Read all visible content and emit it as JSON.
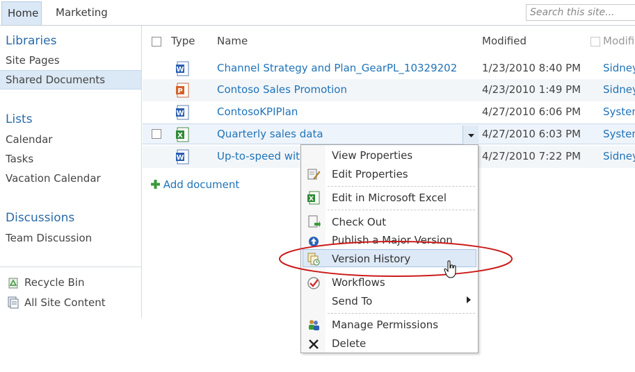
{
  "top_nav": {
    "tabs": [
      {
        "label": "Home"
      },
      {
        "label": "Marketing"
      }
    ],
    "search_placeholder": "Search this site..."
  },
  "left_nav": {
    "libraries": {
      "heading": "Libraries",
      "items": [
        {
          "label": "Site Pages"
        },
        {
          "label": "Shared Documents"
        }
      ]
    },
    "lists": {
      "heading": "Lists",
      "items": [
        {
          "label": "Calendar"
        },
        {
          "label": "Tasks"
        },
        {
          "label": "Vacation Calendar"
        }
      ]
    },
    "discussions": {
      "heading": "Discussions",
      "items": [
        {
          "label": "Team Discussion"
        }
      ]
    },
    "bottom": [
      {
        "label": "Recycle Bin",
        "icon": "recycle-bin-icon"
      },
      {
        "label": "All Site Content",
        "icon": "all-site-content-icon"
      }
    ]
  },
  "list": {
    "columns": {
      "type": "Type",
      "name": "Name",
      "modified": "Modified",
      "modified_by": "Modifi"
    },
    "rows": [
      {
        "icon": "word-doc-icon",
        "name": "Channel Strategy and Plan_GearPL_10329202",
        "modified": "1/23/2010 8:40 PM",
        "modified_by": "Sidney"
      },
      {
        "icon": "powerpoint-doc-icon",
        "name": "Contoso Sales Promotion",
        "modified": "4/23/2010 1:49 PM",
        "modified_by": "Sidney"
      },
      {
        "icon": "word-doc-icon",
        "name": "ContosoKPIPlan",
        "modified": "4/27/2010 6:06 PM",
        "modified_by": "System"
      },
      {
        "icon": "excel-doc-icon",
        "name": "Quarterly sales data",
        "modified": "4/27/2010 6:03 PM",
        "modified_by": "System"
      },
      {
        "icon": "word-doc-icon",
        "name": "Up-to-speed wit",
        "modified": "4/27/2010 7:22 PM",
        "modified_by": "Sidney"
      }
    ],
    "add_document": "Add document"
  },
  "context_menu": {
    "items": [
      {
        "label": "View Properties",
        "icon": ""
      },
      {
        "label": "Edit Properties",
        "icon": "edit-properties-icon"
      },
      {
        "label": "Edit in Microsoft Excel",
        "icon": "excel-icon"
      },
      {
        "label": "Check Out",
        "icon": "check-out-icon"
      },
      {
        "label": "Publish a Major Version",
        "icon": "publish-icon"
      },
      {
        "label": "Version History",
        "icon": "version-history-icon"
      },
      {
        "label": "Workflows",
        "icon": "workflows-icon"
      },
      {
        "label": "Send To",
        "icon": ""
      },
      {
        "label": "Manage Permissions",
        "icon": "manage-permissions-icon"
      },
      {
        "label": "Delete",
        "icon": "delete-icon"
      }
    ]
  },
  "colors": {
    "link": "#1f73b8",
    "highlight": "#dde9f6",
    "annotation": "#cc1a1a"
  }
}
